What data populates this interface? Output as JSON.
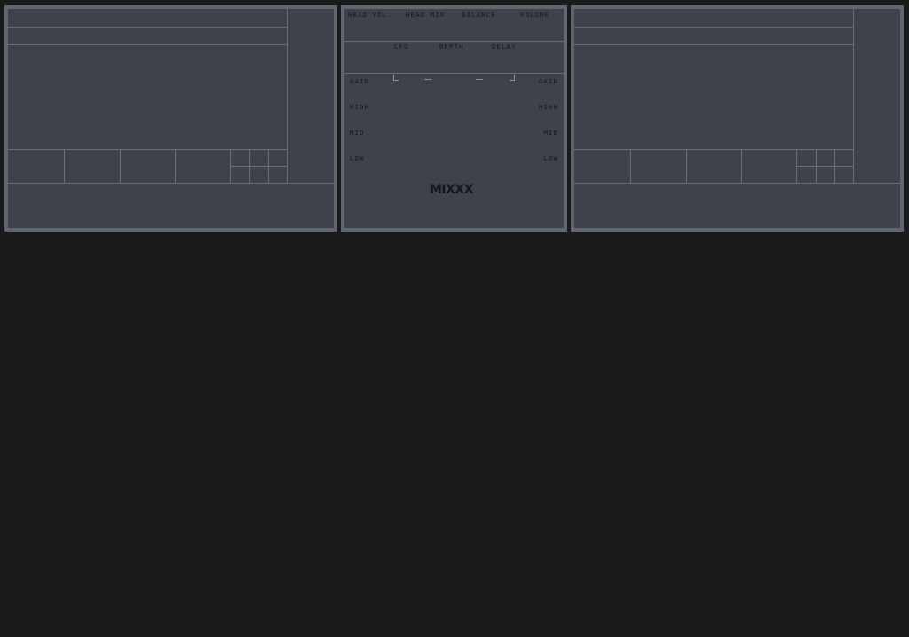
{
  "mixer": {
    "top_labels": {
      "head_vol": "HEAD VOL.",
      "head_mix": "HEAD MIX",
      "balance": "BALANCE",
      "volume": "VOLUME"
    },
    "fx_labels": {
      "lfo": "LFO",
      "depth": "DEPTH",
      "delay": "DELAY"
    },
    "eq_left": {
      "gain": "GAIN",
      "high": "HIGH",
      "mid": "MID",
      "low": "LOW"
    },
    "eq_right": {
      "gain": "GAIN",
      "high": "HIGH",
      "mid": "MID",
      "low": "LOW"
    },
    "logo": "MIXXX"
  },
  "colors": {
    "background": "#1a1a1a",
    "panel_border": "#5f6670",
    "panel_fill": "#3f424a",
    "divider": "#6a6e77",
    "label_text": "#16181c"
  }
}
